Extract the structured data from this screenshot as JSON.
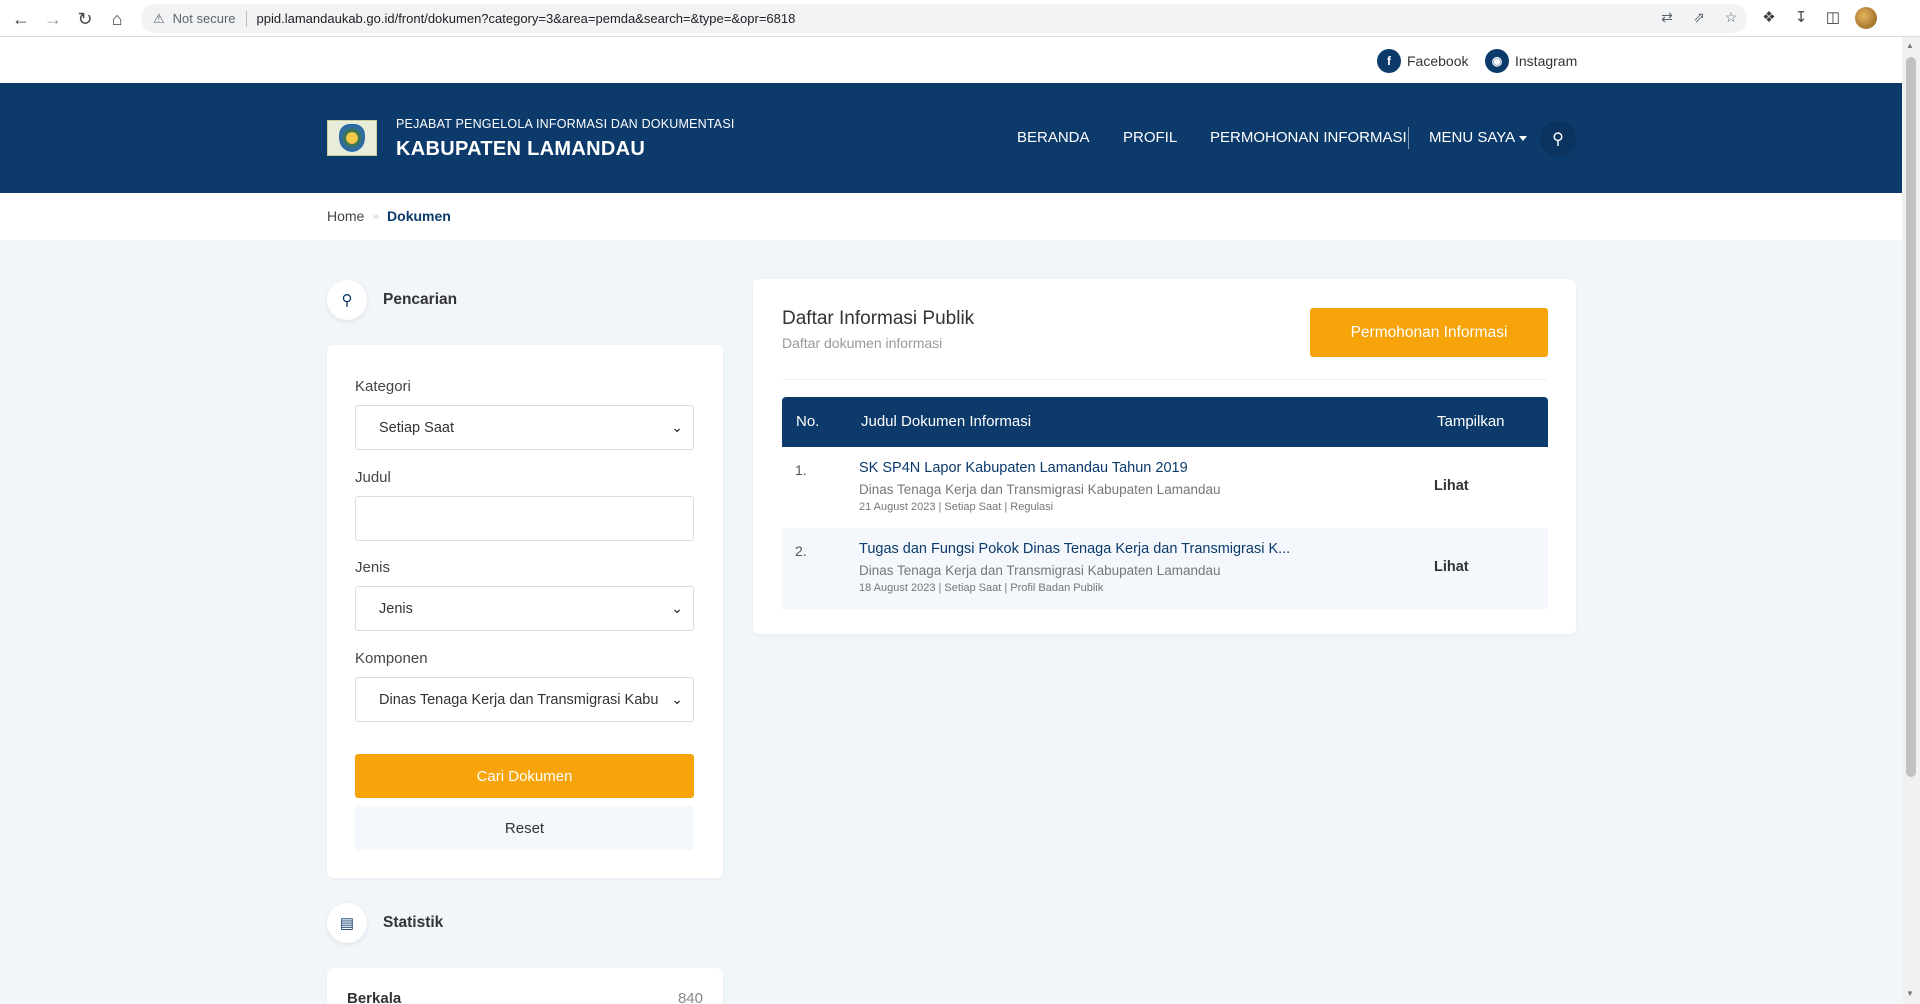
{
  "browser": {
    "security_label": "Not secure",
    "url": "ppid.lamandaukab.go.id/front/dokumen?category=3&area=pemda&search=&type=&opr=6818"
  },
  "social": [
    {
      "label": "Facebook",
      "icon": "facebook-icon"
    },
    {
      "label": "Instagram",
      "icon": "instagram-icon"
    }
  ],
  "header": {
    "subtitle": "PEJABAT PENGELOLA INFORMASI DAN DOKUMENTASI",
    "title": "KABUPATEN LAMANDAU",
    "nav": [
      "BERANDA",
      "PROFIL",
      "PERMOHONAN INFORMASI",
      "MENU SAYA"
    ]
  },
  "breadcrumb": {
    "home": "Home",
    "current": "Dokumen"
  },
  "search": {
    "heading": "Pencarian",
    "kategori_label": "Kategori",
    "kategori_value": "Setiap Saat",
    "judul_label": "Judul",
    "judul_value": "",
    "jenis_label": "Jenis",
    "jenis_value": "Jenis",
    "komponen_label": "Komponen",
    "komponen_value": "Dinas Tenaga Kerja dan Transmigrasi Kabupaten Lamandau",
    "submit_label": "Cari Dokumen",
    "reset_label": "Reset"
  },
  "statistik": {
    "heading": "Statistik",
    "rows": [
      {
        "label": "Berkala",
        "value": "840"
      }
    ]
  },
  "main": {
    "title": "Daftar Informasi Publik",
    "subtitle": "Daftar dokumen informasi",
    "request_button": "Permohonan Informasi",
    "columns": [
      "No.",
      "Judul Dokumen Informasi",
      "Tampilkan"
    ],
    "rows": [
      {
        "no": "1.",
        "title": "SK SP4N Lapor Kabupaten Lamandau Tahun 2019",
        "org": "Dinas Tenaga Kerja dan Transmigrasi Kabupaten Lamandau",
        "meta": "21 August 2023 | Setiap Saat | Regulasi",
        "action": "Lihat"
      },
      {
        "no": "2.",
        "title": "Tugas dan Fungsi Pokok Dinas Tenaga Kerja dan Transmigrasi K...",
        "org": "Dinas Tenaga Kerja dan Transmigrasi Kabupaten Lamandau",
        "meta": "18 August 2023 | Setiap Saat | Profil Badan Publik",
        "action": "Lihat"
      }
    ]
  },
  "colors": {
    "primary": "#0b3a6b",
    "accent": "#f6a40a",
    "background": "#f1f6fb"
  }
}
